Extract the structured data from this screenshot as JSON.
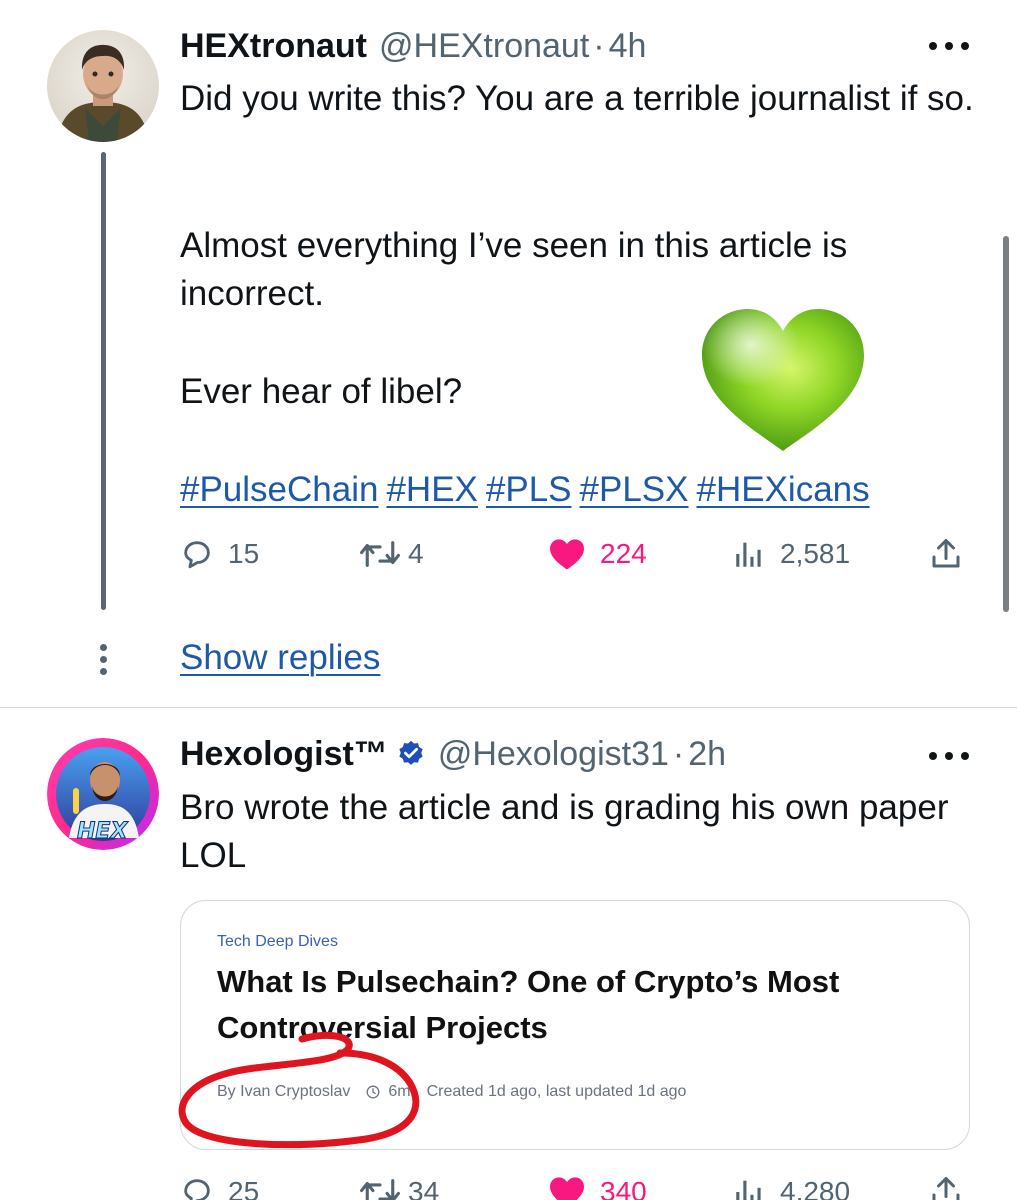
{
  "tweets": [
    {
      "name": "HEXtronaut",
      "handle": "@HEXtronaut",
      "sep": "·",
      "time": "4h",
      "paragraphs": [
        "Did you write this? You are a terrible journalist if so.",
        "Almost everything I’ve seen in this article is incorrect.",
        "Ever hear of libel?"
      ],
      "hashtags": [
        "#PulseChain",
        "#HEX",
        "#PLS",
        "#PLSX",
        "#HEXicans"
      ],
      "stats": {
        "replies": "15",
        "retweets": "4",
        "likes": "224",
        "views": "2,581"
      },
      "show_replies": "Show replies"
    },
    {
      "name": "Hexologist™",
      "handle": "@Hexologist31",
      "sep": "·",
      "time": "2h",
      "paragraphs": [
        "Bro wrote the article and is grading his own paper LOL"
      ],
      "card": {
        "category": "Tech Deep Dives",
        "title": "What Is Pulsechain? One of Crypto’s Most Controversial Projects",
        "author": "By Ivan Cryptoslav",
        "read_time": "6m",
        "created": "Created 1d ago, last updated 1d ago"
      },
      "stats": {
        "replies": "25",
        "retweets": "34",
        "likes": "340",
        "views": "4,280"
      }
    }
  ],
  "colors": {
    "link": "#1d59a8",
    "like": "#f91880",
    "muted": "#536471",
    "verified": "#1d4fb8",
    "annotation": "#e0141e"
  }
}
